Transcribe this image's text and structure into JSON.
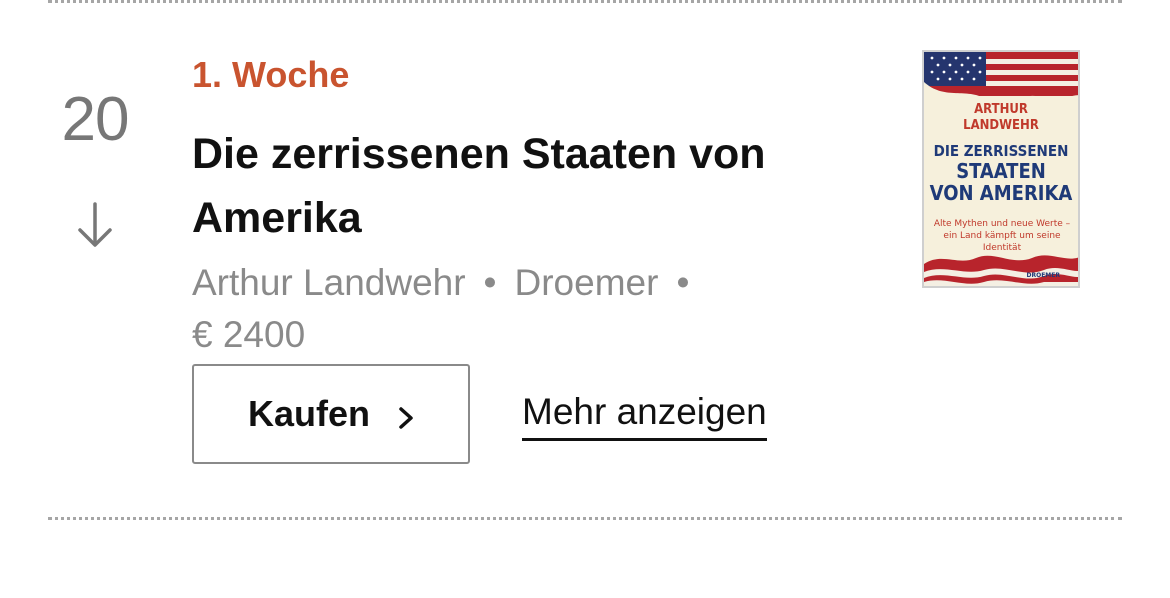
{
  "entry": {
    "rank": "20",
    "trend_icon": "arrow-down-icon",
    "weeks_label": "1. Woche",
    "title": "Die zerrissenen Staaten von Amerika",
    "author": "Arthur Landwehr",
    "separator": "•",
    "publisher": "Droemer",
    "price": "€ 2400",
    "buy_label": "Kaufen",
    "more_label": "Mehr anzeigen"
  },
  "cover": {
    "author_line1": "ARTHUR",
    "author_line2": "LANDWEHR",
    "title_line1": "DIE ZERRISSENEN",
    "title_line2": "STAATEN",
    "title_line3": "VON AMERIKA",
    "subtitle": "Alte Mythen und neue Werte – ein Land kämpft um seine Identität",
    "publisher_mark": "DROEMER"
  },
  "colors": {
    "accent": "#c9542f",
    "muted": "#8a8a8a",
    "rank": "#777777",
    "text": "#111111"
  }
}
